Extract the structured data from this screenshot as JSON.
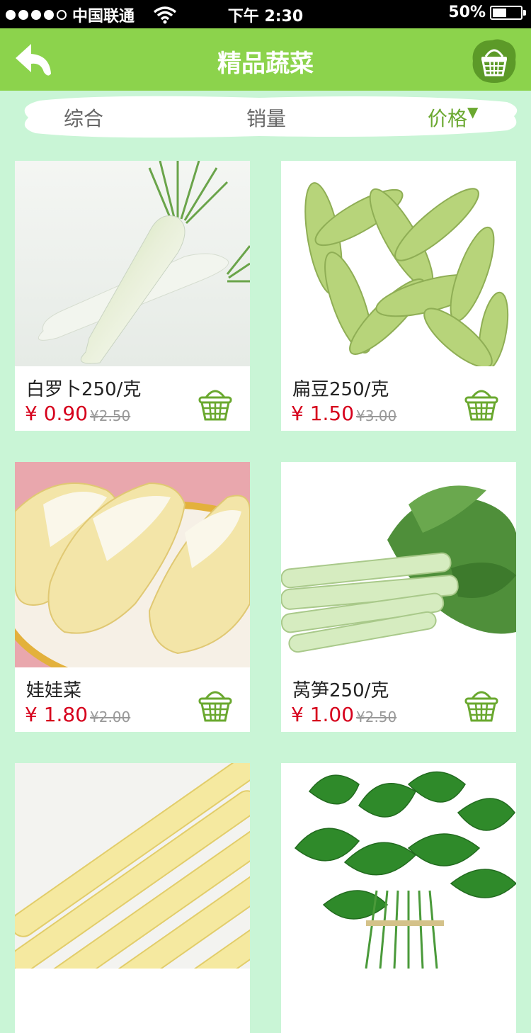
{
  "status_bar": {
    "carrier": "中国联通",
    "time": "下午 2:30",
    "battery": "50%",
    "battery_level": 0.5,
    "signal_bars": 4
  },
  "nav": {
    "title": "精品蔬菜",
    "back_icon": "back-arrow-icon",
    "basket_icon": "basket-icon"
  },
  "filters": {
    "items": [
      "综合",
      "销量",
      "价格"
    ],
    "active": "价格",
    "sort_indicator": "▼"
  },
  "colors": {
    "nav_bg": "#8cd34c",
    "page_bg": "#c9f5d6",
    "price": "#d6001c",
    "accent": "#6aa82f"
  },
  "products": [
    {
      "name": "白罗卜250/克",
      "price": "¥ 0.90",
      "old_price": "¥2.50",
      "image": "white-radish"
    },
    {
      "name": "扁豆250/克",
      "price": "¥ 1.50",
      "old_price": "¥3.00",
      "image": "flat-beans"
    },
    {
      "name": "娃娃菜",
      "price": "¥ 1.80",
      "old_price": "¥2.00",
      "image": "baby-cabbage"
    },
    {
      "name": "莴笋250/克",
      "price": "¥ 1.00",
      "old_price": "¥2.50",
      "image": "lettuce-stem"
    },
    {
      "name": "",
      "price": "",
      "old_price": "",
      "image": "bamboo-shoots"
    },
    {
      "name": "",
      "price": "",
      "old_price": "",
      "image": "water-spinach"
    }
  ]
}
